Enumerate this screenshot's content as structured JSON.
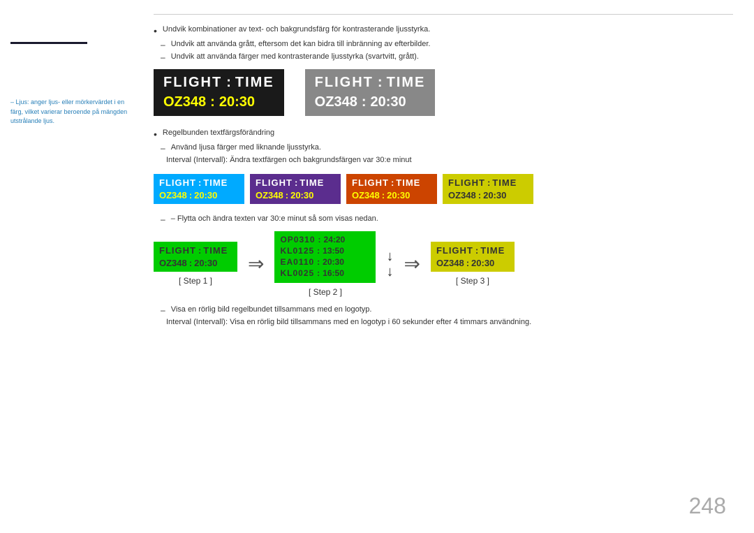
{
  "sidebar": {
    "note": "– Ljus: anger ljus- eller mörkervärdet i en färg, vilket varierar beroende på mängden utstrålande ljus."
  },
  "main": {
    "top_divider": true,
    "bullets": [
      {
        "type": "bullet",
        "text": "Undvik kombinationer av text- och bakgrundsfärg för kontrasterande ljusstyrka."
      },
      {
        "type": "dash",
        "text": "Undvik att använda grått, eftersom det kan bidra till inbränning av efterbilder."
      },
      {
        "type": "dash",
        "text": "Undvik att använda färger med kontrasterande ljusstyrka (svartvitt, grått)."
      }
    ],
    "large_displays": [
      {
        "bg": "black",
        "label_text": "FLIGHT",
        "colon": ":",
        "time_label": "TIME",
        "number": "OZ348",
        "num_colon": ":",
        "time": "20:30"
      },
      {
        "bg": "gray",
        "label_text": "FLIGHT",
        "colon": ":",
        "time_label": "TIME",
        "number": "OZ348",
        "num_colon": ":",
        "time": "20:30"
      }
    ],
    "bullets2": [
      {
        "type": "bullet",
        "text": "Regelbunden textfärgsförändring"
      },
      {
        "type": "dash",
        "text": "Använd ljusa färger med liknande ljusstyrka."
      },
      {
        "type": "dash",
        "text": "Interval (Intervall): Ändra textfärgen och bakgrundsfärgen var 30:e minut"
      }
    ],
    "four_boxes": [
      {
        "bg": "cyan",
        "label": "FLIGHT",
        "colon": ":",
        "time_label": "TIME",
        "number": "OZ348",
        "num_colon": ":",
        "time": "20:30"
      },
      {
        "bg": "purple",
        "label": "FLIGHT",
        "colon": ":",
        "time_label": "TIME",
        "number": "OZ348",
        "num_colon": ":",
        "time": "20:30"
      },
      {
        "bg": "orange",
        "label": "FLIGHT",
        "colon": ":",
        "time_label": "TIME",
        "number": "OZ348",
        "num_colon": ":",
        "time": "20:30"
      },
      {
        "bg": "yellow",
        "label": "FLIGHT",
        "colon": ":",
        "time_label": "TIME",
        "number": "OZ348",
        "num_colon": ":",
        "time": "20:30"
      }
    ],
    "step_note": "– Flytta och ändra texten var 30:e minut så som visas nedan.",
    "steps": [
      {
        "label": "[ Step 1 ]",
        "flights": [
          {
            "label": "FLIGHT",
            "colon": ":",
            "time_label": "TIME"
          },
          {
            "number": "OZ348",
            "num_colon": ":",
            "time": "20:30"
          }
        ]
      },
      {
        "label": "[ Step 2 ]",
        "multi_flights": [
          {
            "code": "OP0310",
            "colon": ":",
            "time": "24:20"
          },
          {
            "code": "KL0125",
            "colon": ":",
            "time": "13:50"
          },
          {
            "code": "EA0110",
            "colon": ":",
            "time": "20:30"
          },
          {
            "code": "KL0025",
            "colon": ":",
            "time": "16:50"
          }
        ]
      },
      {
        "label": "[ Step 3 ]",
        "flights": [
          {
            "label": "FLIGHT",
            "colon": ":",
            "time_label": "TIME"
          },
          {
            "number": "OZ348",
            "num_colon": ":",
            "time": "20:30"
          }
        ]
      }
    ],
    "bottom_notes": [
      {
        "type": "dash",
        "text": "Visa en rörlig bild regelbundet tillsammans med en logotyp."
      },
      {
        "type": "dash",
        "text": "Interval (Intervall): Visa en rörlig bild tillsammans med en logotyp i 60 sekunder efter 4 timmars användning."
      }
    ],
    "page_number": "248"
  }
}
